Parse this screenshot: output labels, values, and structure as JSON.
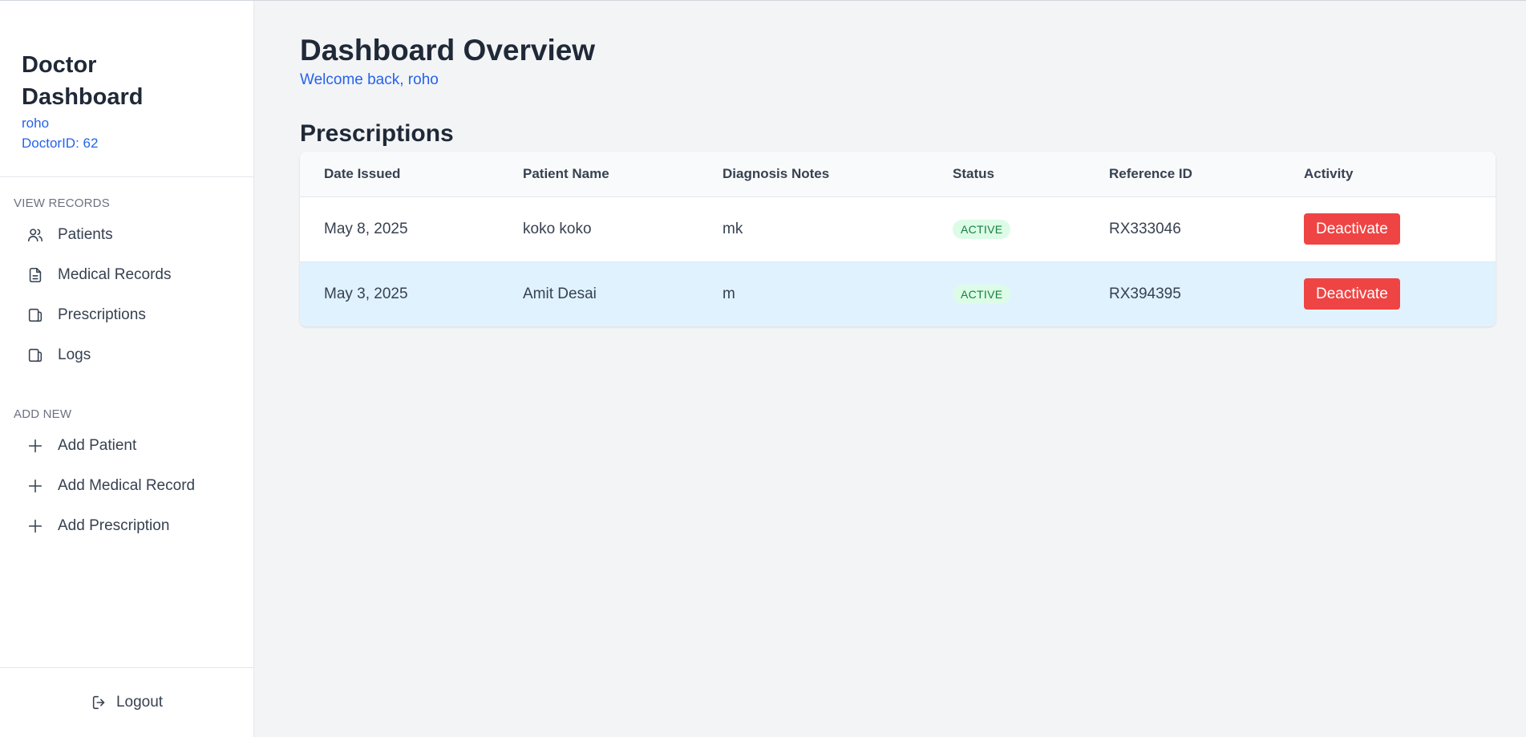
{
  "sidebar": {
    "title": "Doctor Dashboard",
    "username": "roho",
    "doctor_id": "DoctorID: 62",
    "view_records_label": "VIEW RECORDS",
    "view_items": [
      {
        "label": "Patients",
        "icon": "users-icon"
      },
      {
        "label": "Medical Records",
        "icon": "document-icon"
      },
      {
        "label": "Prescriptions",
        "icon": "copy-icon"
      },
      {
        "label": "Logs",
        "icon": "copy-icon"
      }
    ],
    "add_new_label": "ADD NEW",
    "add_items": [
      {
        "label": "Add Patient",
        "icon": "plus-icon"
      },
      {
        "label": "Add Medical Record",
        "icon": "plus-icon"
      },
      {
        "label": "Add Prescription",
        "icon": "plus-icon"
      }
    ],
    "logout_label": "Logout"
  },
  "main": {
    "title": "Dashboard Overview",
    "welcome": "Welcome back, roho",
    "section_title": "Prescriptions"
  },
  "table": {
    "headers": [
      "Date Issued",
      "Patient Name",
      "Diagnosis Notes",
      "Status",
      "Reference ID",
      "Activity"
    ],
    "rows": [
      {
        "date": "May 8, 2025",
        "patient": "koko koko",
        "notes": "mk",
        "status": "ACTIVE",
        "ref": "RX333046",
        "action": "Deactivate"
      },
      {
        "date": "May 3, 2025",
        "patient": "Amit Desai",
        "notes": "m",
        "status": "ACTIVE",
        "ref": "RX394395",
        "action": "Deactivate"
      }
    ]
  },
  "colors": {
    "accent": "#2563eb",
    "danger": "#ef4444",
    "active_badge_bg": "#dcfce7",
    "active_badge_text": "#15803d",
    "highlight_row": "#e0f2fe"
  }
}
